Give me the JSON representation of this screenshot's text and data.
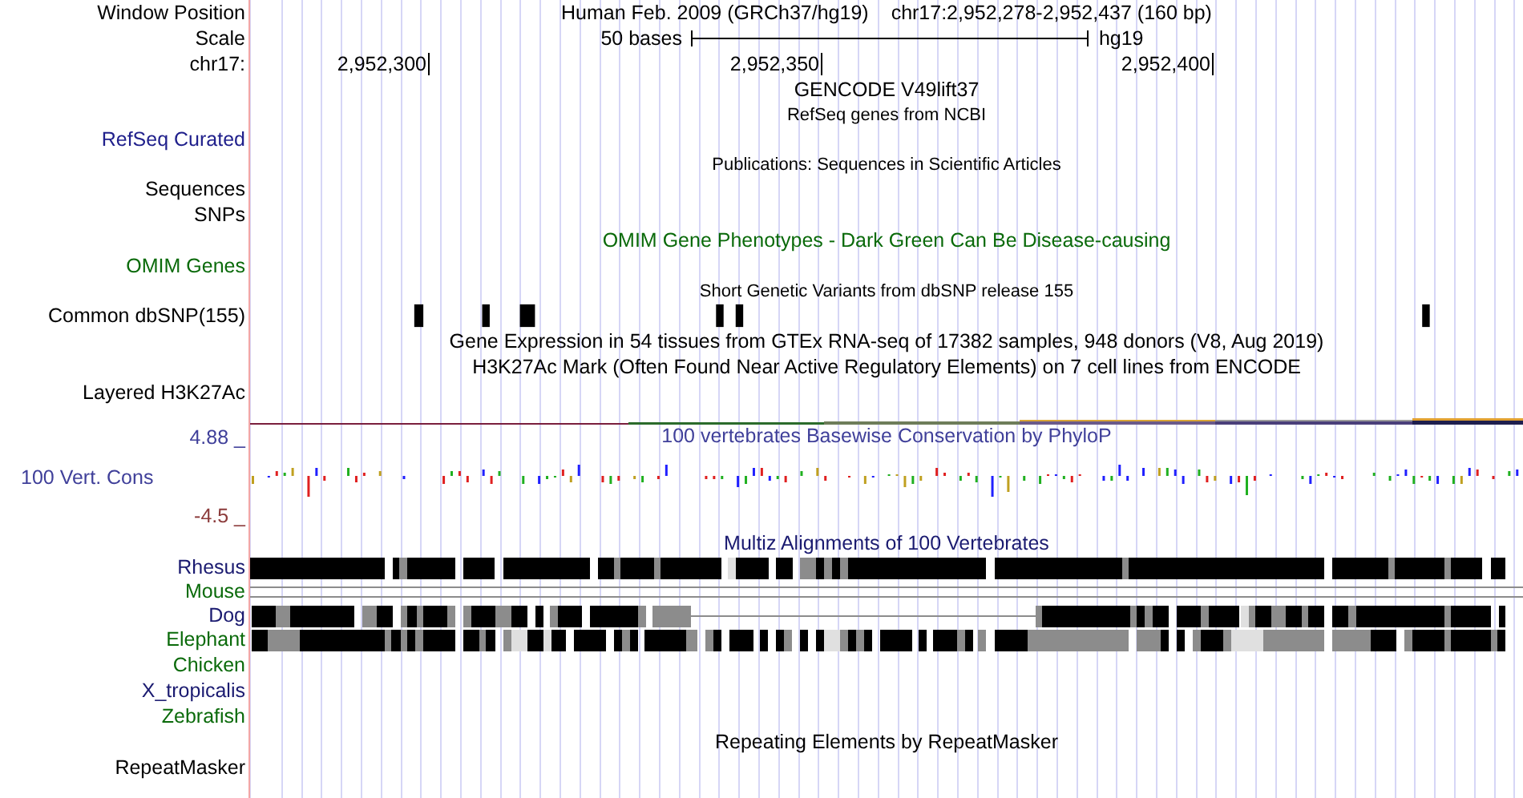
{
  "header": {
    "label": "Window Position",
    "assembly": "Human Feb. 2009 (GRCh37/hg19)",
    "position": "chr17:2,952,278-2,952,437 (160 bp)"
  },
  "scale": {
    "label": "Scale",
    "length": "50 bases",
    "genome": "hg19"
  },
  "ruler": {
    "label": "chr17:",
    "ticks": [
      "2,952,300",
      "2,952,350",
      "2,952,400"
    ]
  },
  "tracks": [
    {
      "kind": "heading",
      "title": "GENCODE V49lift37"
    },
    {
      "kind": "caption",
      "title": "RefSeq genes from NCBI"
    },
    {
      "kind": "label",
      "label": "RefSeq Curated",
      "color": "#20208c"
    },
    {
      "kind": "caption",
      "title": "Publications: Sequences in Scientific Articles"
    },
    {
      "kind": "label",
      "label": "Sequences"
    },
    {
      "kind": "label",
      "label": "SNPs"
    },
    {
      "kind": "heading",
      "title": "OMIM Gene Phenotypes - Dark Green Can Be Disease-causing",
      "color": "#0a6a0a"
    },
    {
      "kind": "label",
      "label": "OMIM Genes",
      "color": "#0a6a0a"
    },
    {
      "kind": "caption",
      "title": "Short Genetic Variants from dbSNP release 155"
    },
    {
      "kind": "snp",
      "label": "Common dbSNP(155)"
    },
    {
      "kind": "heading",
      "title": "Gene Expression in 54 tissues from GTEx RNA-seq of 17382 samples, 948 donors (V8, Aug 2019)"
    },
    {
      "kind": "heading",
      "title": "H3K27Ac Mark (Often Found Near Active Regulatory Elements) on 7 cell lines from ENCODE"
    },
    {
      "kind": "label",
      "label": "Layered H3K27Ac"
    },
    {
      "kind": "layered"
    },
    {
      "kind": "conservation",
      "title": "100 vertebrates Basewise Conservation by PhyloP",
      "label": "100 Vert. Cons",
      "color": "#40409a",
      "max": "4.88 _",
      "min": "-4.5 _"
    },
    {
      "kind": "heading",
      "title": "Multiz Alignments of 100 Vertebrates",
      "color": "#1a1a70"
    },
    {
      "kind": "blocks",
      "label": "Rhesus",
      "color": "#1a1a70"
    },
    {
      "kind": "lines",
      "label": "Mouse",
      "color": "#0a6a0a"
    },
    {
      "kind": "blocks",
      "label": "Dog",
      "color": "#1a1a70"
    },
    {
      "kind": "blocks",
      "label": "Elephant",
      "color": "#0a6a0a"
    },
    {
      "kind": "label",
      "label": "Chicken",
      "color": "#0a6a0a"
    },
    {
      "kind": "label",
      "label": "X_tropicalis",
      "color": "#1a1a70"
    },
    {
      "kind": "label",
      "label": "Zebrafish",
      "color": "#0a6a0a"
    },
    {
      "kind": "heading",
      "title": "Repeating Elements by RepeatMasker"
    },
    {
      "kind": "label",
      "label": "RepeatMasker"
    }
  ]
}
